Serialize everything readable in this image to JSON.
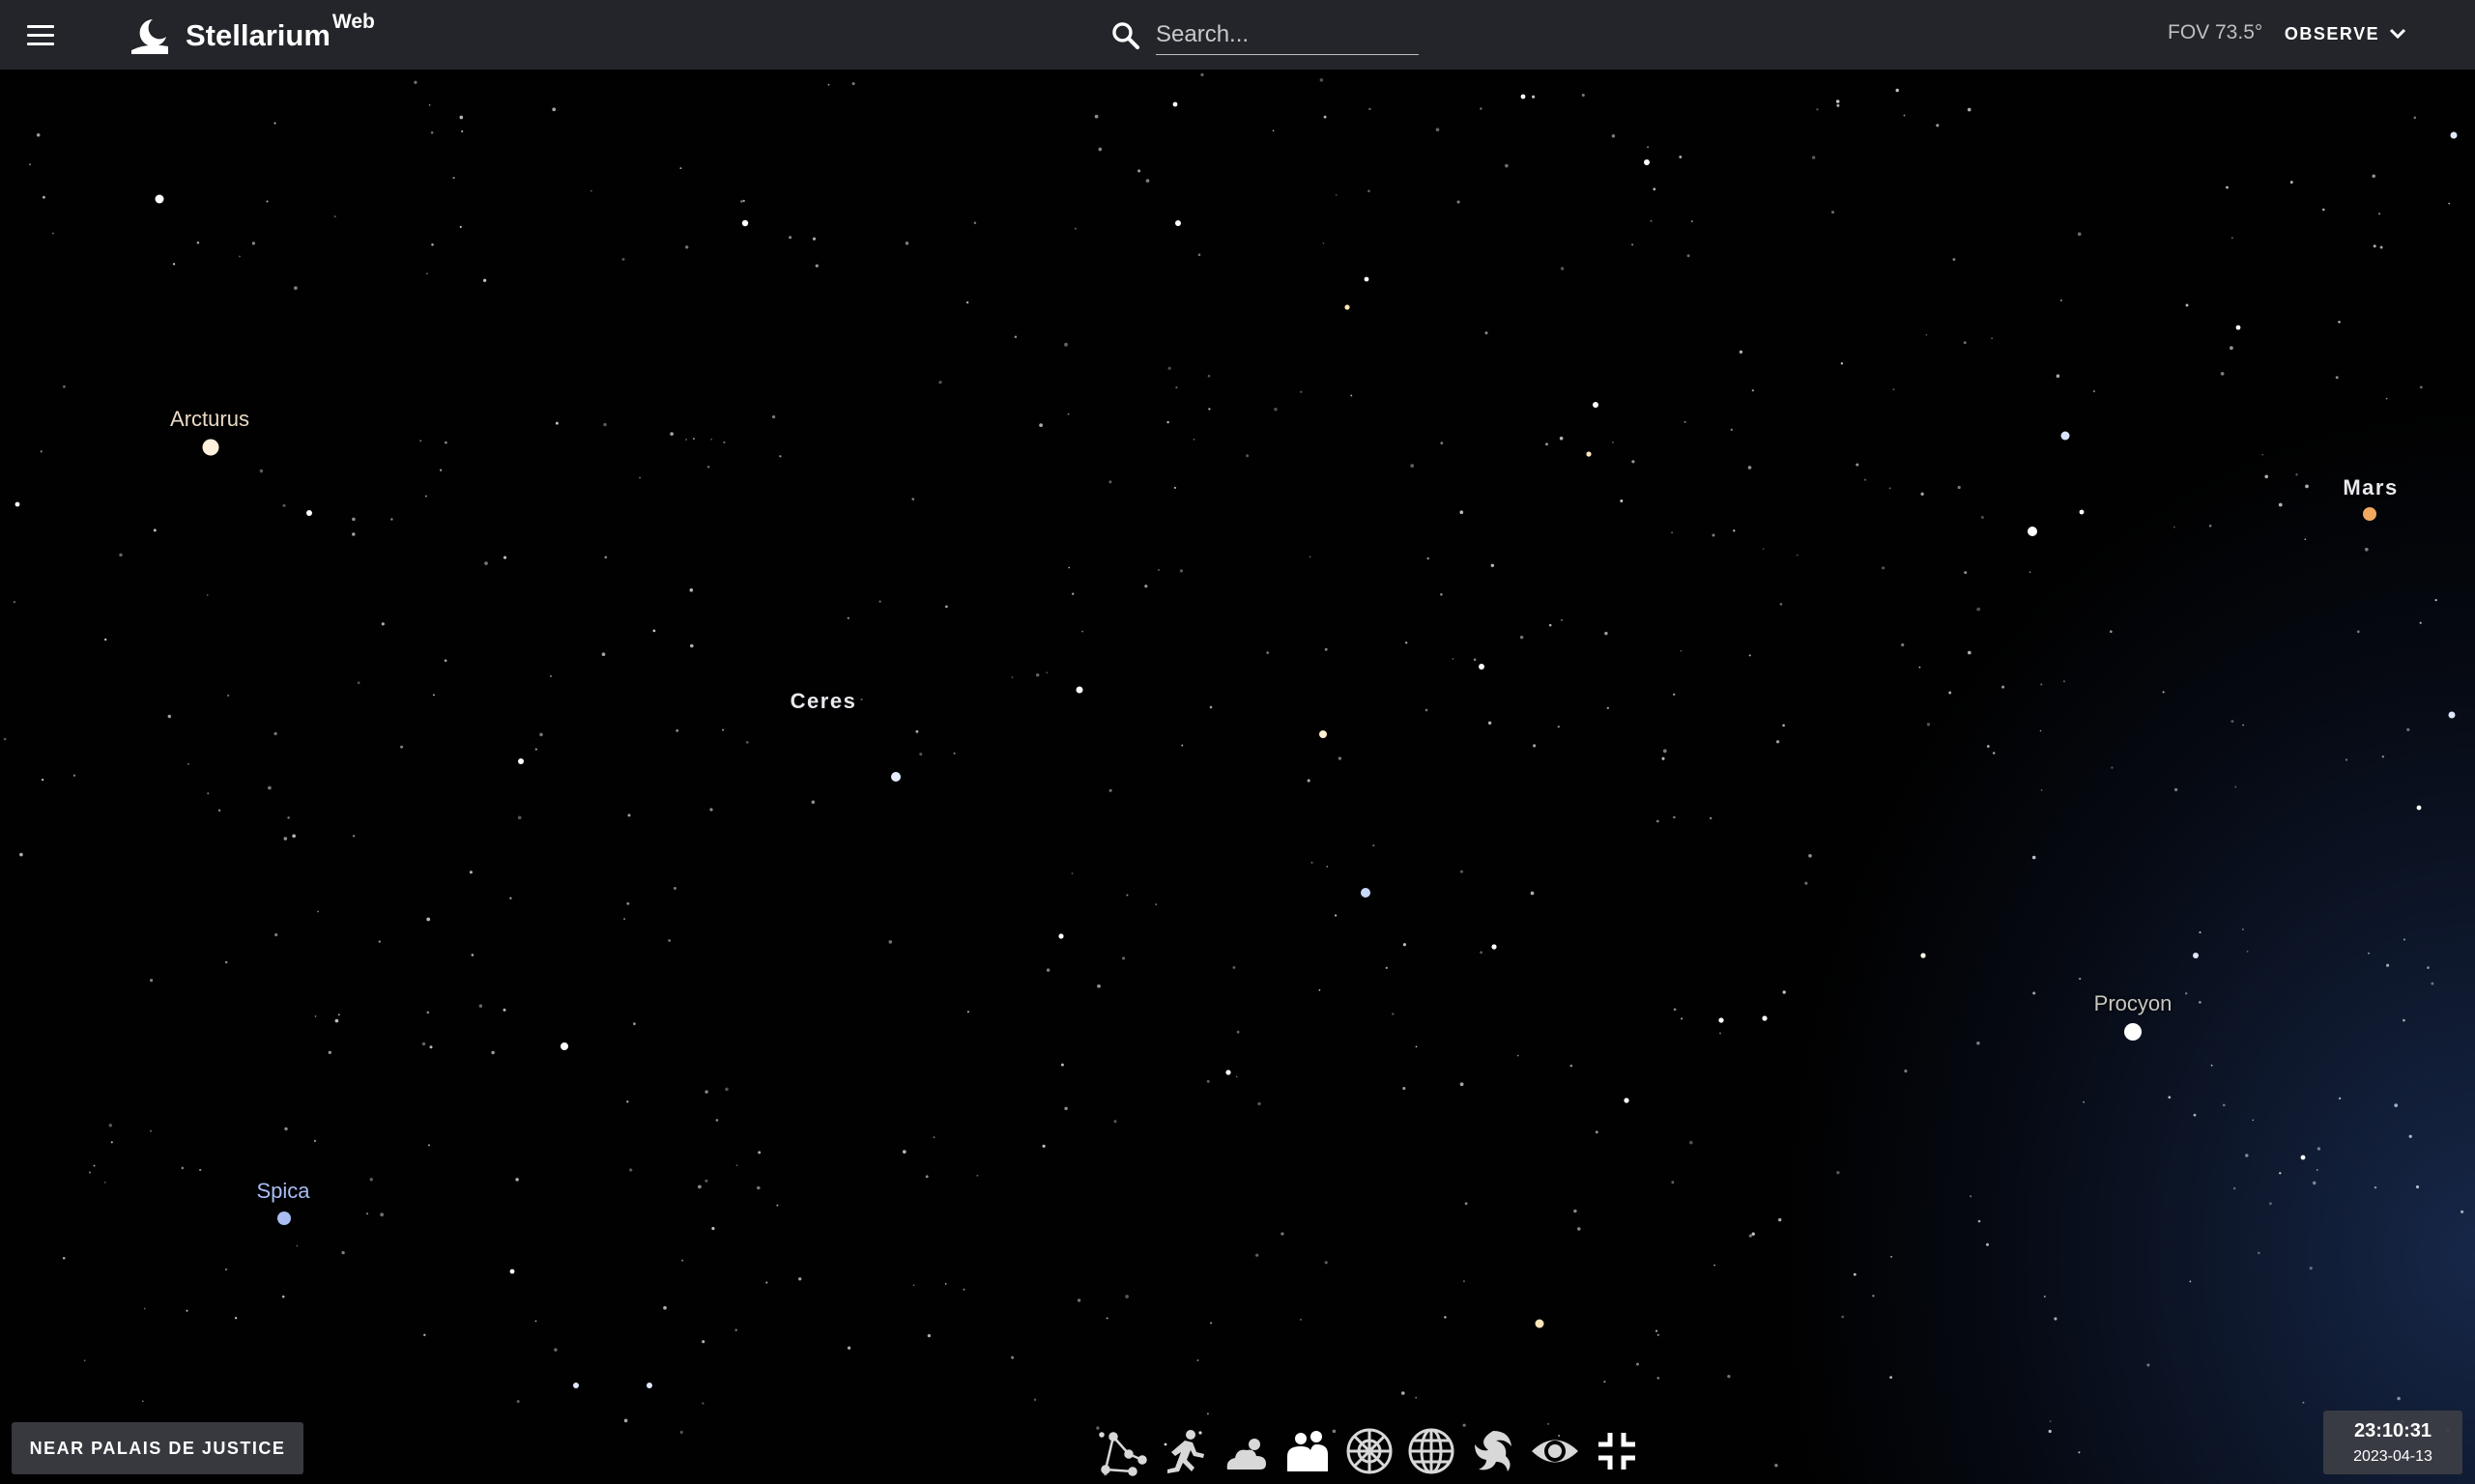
{
  "app": {
    "name": "Stellarium",
    "name_sup": "Web"
  },
  "search": {
    "placeholder": "Search..."
  },
  "fov": "FOV 73.5°",
  "observe_label": "OBSERVE",
  "sky_labels": {
    "arcturus": "Arcturus",
    "spica": "Spica",
    "ceres": "Ceres",
    "mars": "Mars",
    "procyon": "Procyon"
  },
  "location": "NEAR PALAIS DE JUSTICE",
  "time": "23:10:31",
  "date": "2023-04-13",
  "toolbar_icons": [
    "constellation-lines-icon",
    "constellation-art-icon",
    "atmosphere-icon",
    "landscape-icon",
    "azimuthal-grid-icon",
    "equatorial-grid-icon",
    "deep-sky-objects-icon",
    "night-mode-icon",
    "exit-fullscreen-icon"
  ],
  "colors": {
    "topbar": "#26282e",
    "sky": "#010101",
    "milky_way_tint": "#284682",
    "mars": "#f0a860",
    "spica": "#a9bdf2"
  }
}
